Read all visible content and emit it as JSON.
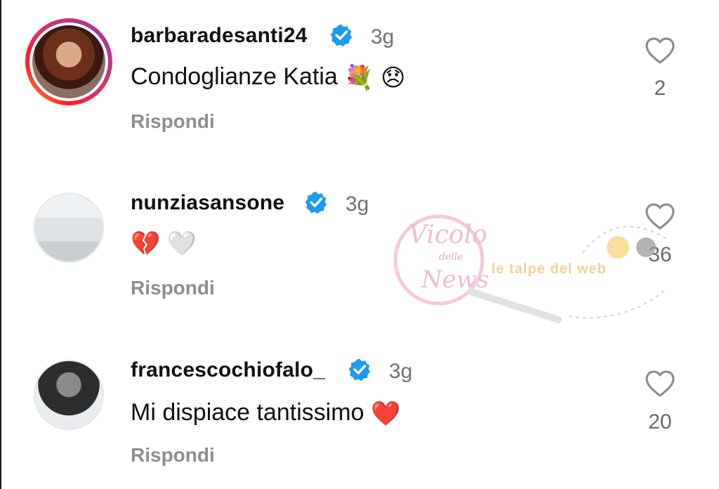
{
  "comments": [
    {
      "username": "barbaradesanti24",
      "time": "3g",
      "text": "Condoglianze Katia",
      "emojis": [
        "💐",
        "😞"
      ],
      "reply_label": "Rispondi",
      "likes": "2"
    },
    {
      "username": "nunziasansone",
      "time": "3g",
      "text": "",
      "emojis": [
        "💔",
        "🤍"
      ],
      "reply_label": "Rispondi",
      "likes": "36"
    },
    {
      "username": "francescochiofalo_",
      "time": "3g",
      "text": "Mi dispiace tantissimo",
      "emojis": [
        "❤️"
      ],
      "reply_label": "Rispondi",
      "likes": "20"
    }
  ],
  "watermark": {
    "brand_top": "Vicolo",
    "brand_mid": "delle",
    "brand_bottom": "News",
    "tagline": "le talpe del web"
  },
  "colors": {
    "verified": "#1d9bf0",
    "muted": "#8e8e8e",
    "heart_red": "#e0245e"
  }
}
